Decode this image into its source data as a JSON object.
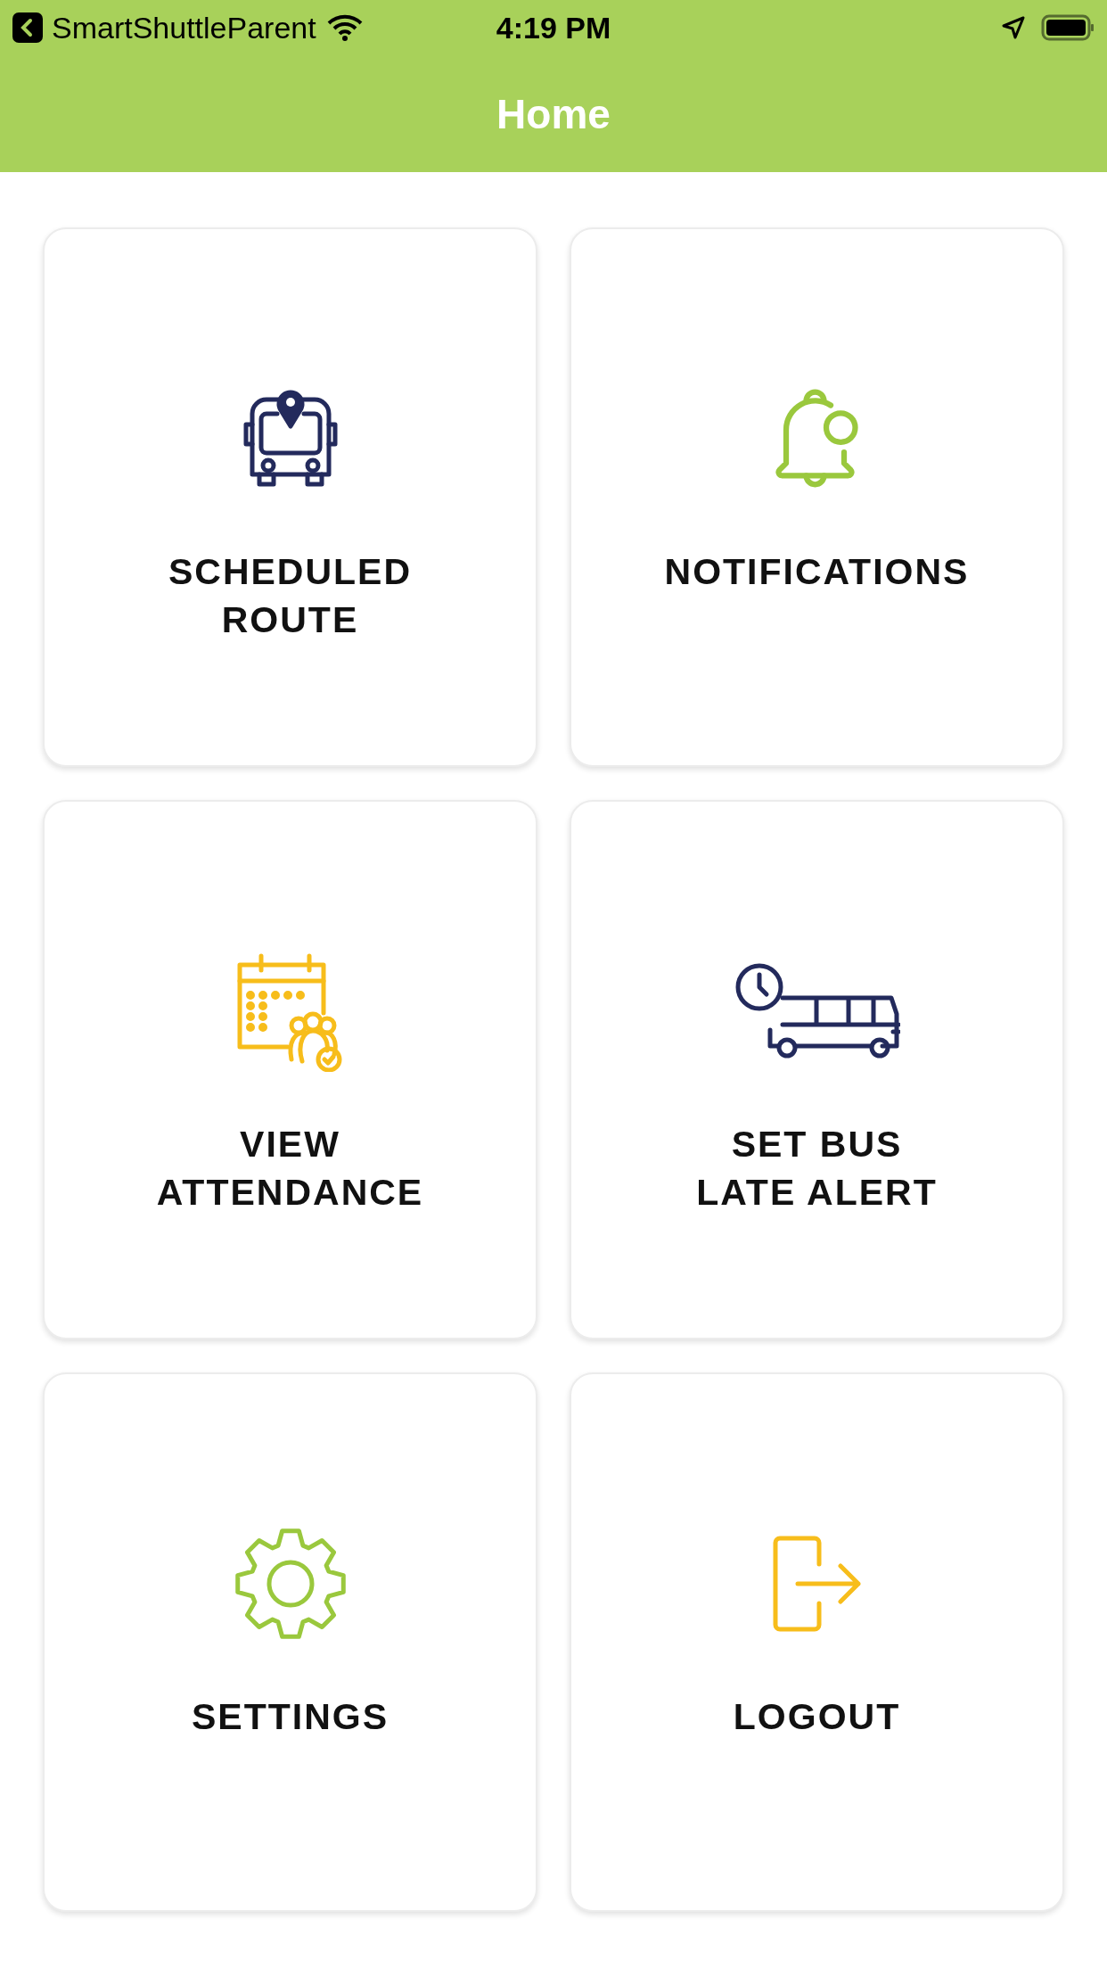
{
  "status_bar": {
    "back_app": "SmartShuttleParent",
    "time": "4:19 PM"
  },
  "header": {
    "title": "Home"
  },
  "tiles": [
    {
      "kind": "route",
      "lines": [
        "SCHEDULED",
        "ROUTE"
      ]
    },
    {
      "kind": "bell",
      "lines": [
        "NOTIFICATIONS"
      ]
    },
    {
      "kind": "attendance",
      "lines": [
        "VIEW",
        "ATTENDANCE"
      ]
    },
    {
      "kind": "bus-late",
      "lines": [
        "SET BUS",
        "LATE ALERT"
      ]
    },
    {
      "kind": "settings",
      "lines": [
        "SETTINGS"
      ]
    },
    {
      "kind": "logout",
      "lines": [
        "LOGOUT"
      ]
    }
  ]
}
